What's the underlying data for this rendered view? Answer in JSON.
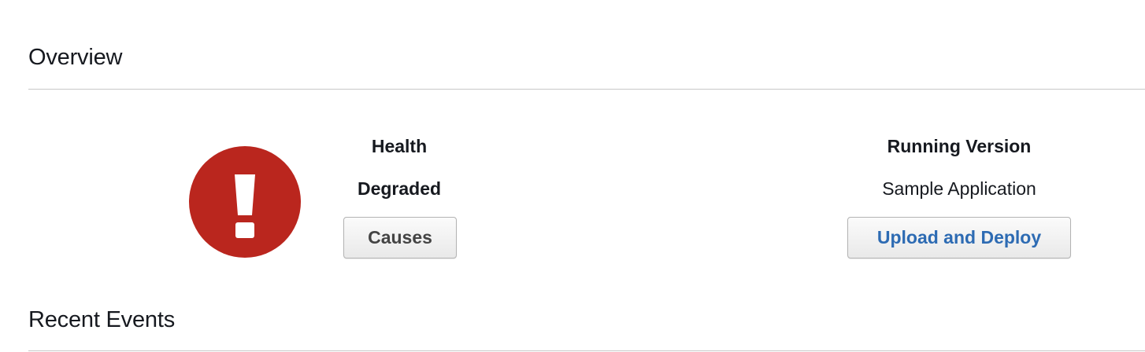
{
  "sections": {
    "overview_title": "Overview",
    "recent_events_title": "Recent Events"
  },
  "health": {
    "icon": "exclamation-circle-icon",
    "icon_color": "#ba261e",
    "label": "Health",
    "status": "Degraded",
    "causes_button": "Causes"
  },
  "running_version": {
    "label": "Running Version",
    "value": "Sample Application",
    "upload_deploy_button": "Upload and Deploy",
    "button_text_color": "#2d6bb3"
  }
}
